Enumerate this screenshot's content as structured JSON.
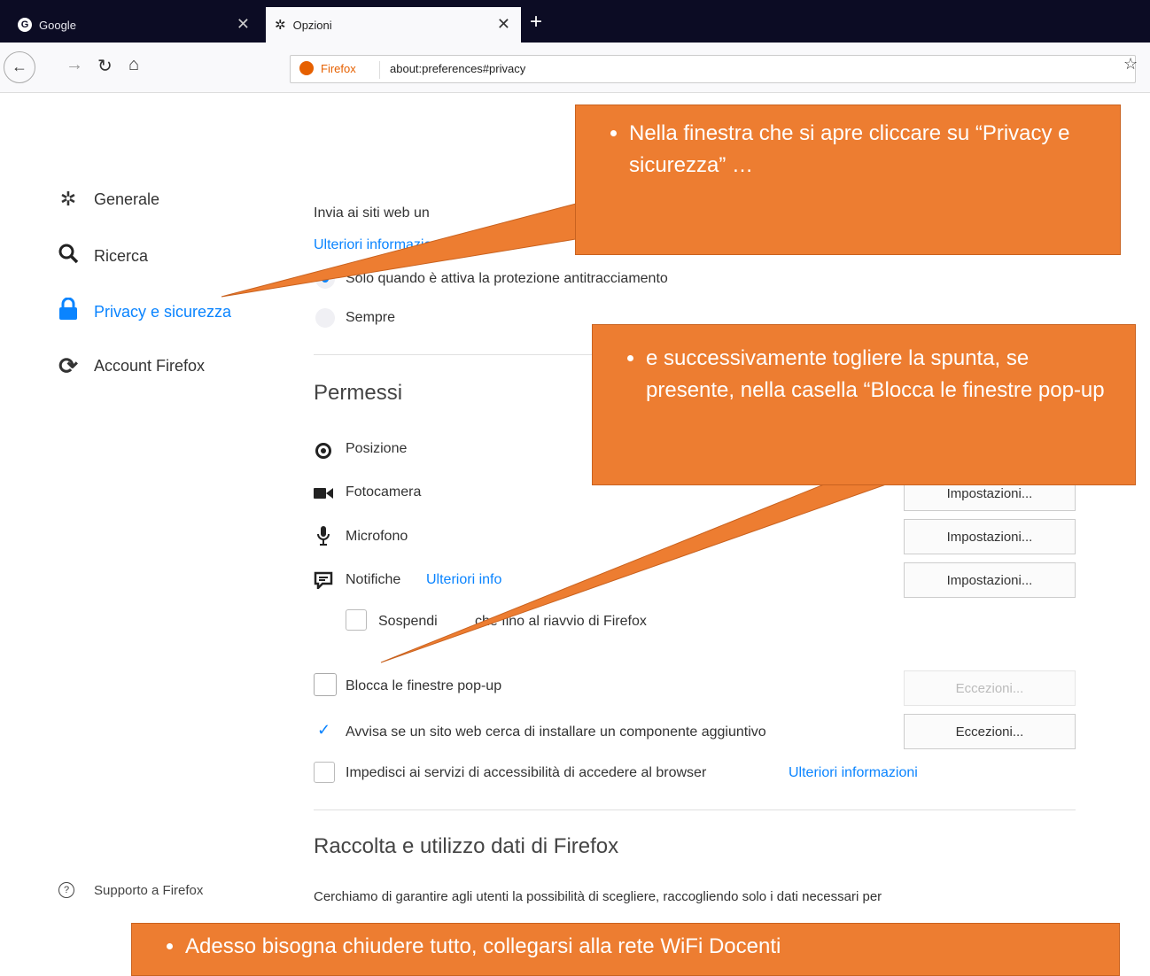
{
  "browser": {
    "tabs": [
      {
        "label": "Google",
        "icon": "google-icon",
        "active": false
      },
      {
        "label": "Opzioni",
        "icon": "gear-icon",
        "active": true
      }
    ],
    "new_tab": "+",
    "url_identity": "Firefox",
    "url": "about:preferences#privacy"
  },
  "sidebar": {
    "items": [
      {
        "label": "Generale",
        "icon": "gear-icon"
      },
      {
        "label": "Ricerca",
        "icon": "search-icon"
      },
      {
        "label": "Privacy e sicurezza",
        "icon": "lock-icon",
        "selected": true
      },
      {
        "label": "Account Firefox",
        "icon": "sync-icon"
      }
    ],
    "support": "Supporto a Firefox"
  },
  "dnt": {
    "text": "Invia ai siti web un",
    "link": "Ulteriori informazioni",
    "option1": "Solo quando è attiva la protezione antitracciamento",
    "option2": "Sempre"
  },
  "permissions": {
    "heading": "Permessi",
    "items": [
      {
        "label": "Posizione",
        "icon": "location-icon"
      },
      {
        "label": "Fotocamera",
        "icon": "camera-icon",
        "button": "Impostazioni..."
      },
      {
        "label": "Microfono",
        "icon": "microphone-icon",
        "button": "Impostazioni..."
      },
      {
        "label": "Notifiche",
        "icon": "notification-icon",
        "link": "Ulteriori info",
        "button": "Impostazioni..."
      }
    ],
    "suspend_prefix": "Sospendi",
    "suspend_suffix": "che fino al riavvio di Firefox",
    "popup": {
      "label": "Blocca le finestre pop-up",
      "button": "Eccezioni...",
      "checked": false
    },
    "addon": {
      "label": "Avvisa se un sito web cerca di installare un componente aggiuntivo",
      "button": "Eccezioni...",
      "checked": true
    },
    "accessibility": {
      "label": "Impedisci ai servizi di accessibilità di accedere al browser",
      "link": "Ulteriori informazioni",
      "checked": false
    }
  },
  "data_collection": {
    "heading": "Raccolta e utilizzo dati di Firefox",
    "text": "Cerchiamo di garantire agli utenti la possibilità di scegliere, raccogliendo solo i dati necessari per"
  },
  "callouts": {
    "first": "Nella finestra che si apre cliccare su “Privacy e sicurezza” …",
    "second": "e successivamente togliere la spunta, se presente, nella casella “Blocca le finestre pop-up",
    "third": "Adesso bisogna chiudere tutto, collegarsi alla rete WiFi  Docenti"
  },
  "colors": {
    "accent": "#0a84ff",
    "callout": "#ed7d31",
    "tabbar": "#0c0c24"
  }
}
